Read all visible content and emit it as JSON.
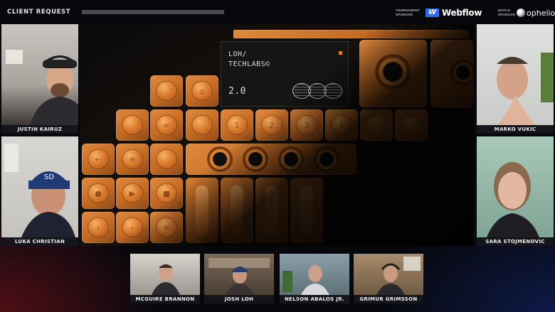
{
  "header": {
    "show_title": "CLIENT REQUEST",
    "sponsor_left_label_1": "TOURNAMENT",
    "sponsor_left_label_2": "SPONSOR",
    "sponsor_left_name": "Webflow",
    "sponsor_right_label_1": "MATCH",
    "sponsor_right_label_2": "SPONSOR",
    "sponsor_right_name": "ophelio"
  },
  "device_screen": {
    "line1": "LOH/",
    "line2": "TECHLABS©",
    "version": "2.0"
  },
  "keypad_numbers": [
    "1",
    "2",
    "3",
    "4"
  ],
  "left_participants": [
    {
      "name": "JUSTIN KAIRUZ"
    },
    {
      "name": "LUKA CHRISTIAN"
    }
  ],
  "right_participants": [
    {
      "name": "MARKO VUKIC"
    },
    {
      "name": "SARA STOJMENOVIC"
    }
  ],
  "bottom_participants": [
    {
      "name": "MCGUIRE BRANNON"
    },
    {
      "name": "JOSH LOH"
    },
    {
      "name": "NELSON ABALOS JR."
    },
    {
      "name": "GRIMUR GRIMSSON"
    }
  ],
  "colors": {
    "accent_orange": "#d9822f",
    "webflow_blue": "#2b6cf0",
    "nameplate_bg": "#14161c"
  }
}
